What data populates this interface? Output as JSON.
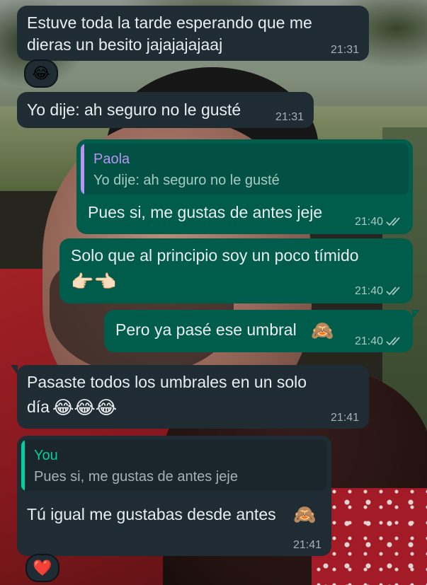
{
  "messages": [
    {
      "id": "m1",
      "direction": "incoming",
      "text_line1": "Estuve toda la tarde esperando que me",
      "text_line2": "dieras un besito jajajajajaaj",
      "time": "21:31",
      "reaction": "😂"
    },
    {
      "id": "m2",
      "direction": "incoming",
      "text": "Yo dije: ah seguro no le gusté",
      "time": "21:31"
    },
    {
      "id": "m3",
      "direction": "outgoing",
      "quote": {
        "author": "Paola",
        "text": "Yo dije: ah seguro no le gusté",
        "author_color": "#b794f4"
      },
      "text": "Pues si, me gustas de antes jeje",
      "time": "21:40",
      "status": "read"
    },
    {
      "id": "m4",
      "direction": "outgoing",
      "text": "Solo que al principio soy un poco tímido",
      "emoji_line": "👉🏻👈🏻",
      "time": "21:40",
      "status": "read"
    },
    {
      "id": "m5",
      "direction": "outgoing",
      "text": "Pero ya pasé ese umbral",
      "emoji": "🙈",
      "time": "21:40",
      "status": "read"
    },
    {
      "id": "m6",
      "direction": "incoming",
      "text_line1": "Pasaste todos los umbrales en un solo",
      "text_line2": "día",
      "emoji": "😂😂😂",
      "time": "21:41"
    },
    {
      "id": "m7",
      "direction": "incoming",
      "quote": {
        "author": "You",
        "text": "Pues si, me gustas de antes jeje",
        "author_color": "#06cf9c"
      },
      "text": "Tú igual me gustaba desde antes",
      "text_full": "Tú igual me gustabas desde antes",
      "emoji": "🙈",
      "time": "21:41",
      "reaction": "❤️"
    }
  ],
  "colors": {
    "incoming_bg": "#1f2c34",
    "outgoing_bg": "#005c4b",
    "read_ticks": "#a7cbc1"
  }
}
